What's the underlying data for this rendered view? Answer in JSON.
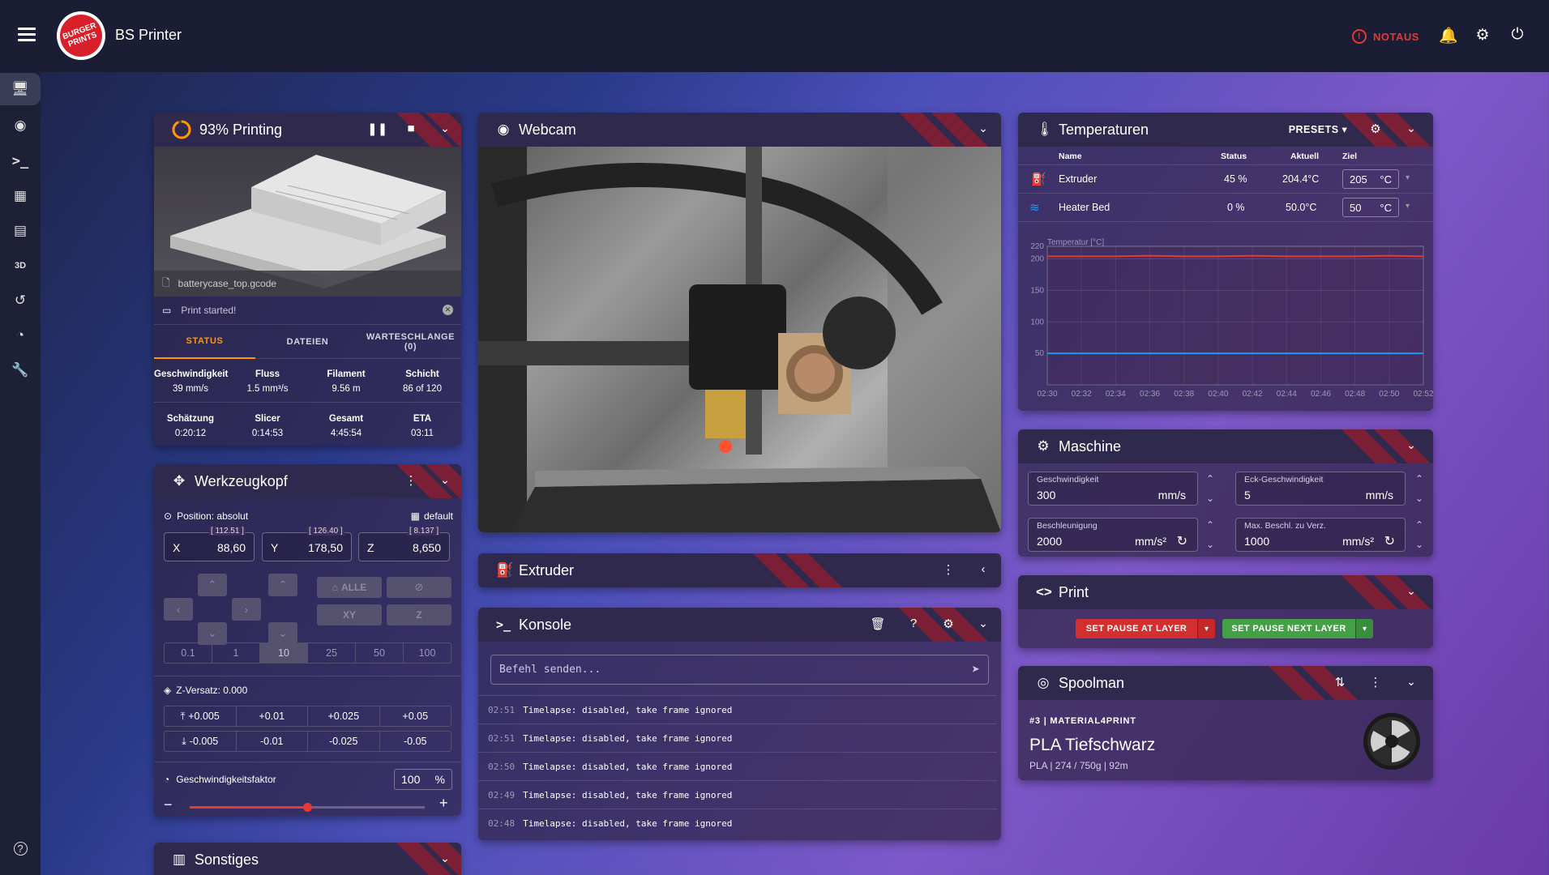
{
  "app": {
    "title": "BS Printer",
    "logo_text": "BURGER PRINTS",
    "notaus": "NOTAUS"
  },
  "colors": {
    "accent": "#e53935",
    "stripe": "#7a1f36",
    "panel_header": "#2f2a4d",
    "progress": "#ff9800",
    "green": "#4caf50"
  },
  "sidebar": {
    "items": [
      "dashboard-icon",
      "webcam-icon",
      "console-icon",
      "heightmap-icon",
      "files-icon",
      "3d-viewer-icon",
      "history-icon",
      "timelapse-icon",
      "settings-icon"
    ],
    "help": "?",
    "label_3d": "3D"
  },
  "status": {
    "title": "93% Printing",
    "progress": 0.93,
    "filename": "batterycase_top.gcode",
    "message": "Print started!",
    "tabs": [
      "STATUS",
      "DATEIEN",
      "WARTESCHLANGE (0)"
    ],
    "stats1": [
      {
        "label": "Geschwindigkeit",
        "value": "39 mm/s"
      },
      {
        "label": "Fluss",
        "value": "1.5 mm³/s"
      },
      {
        "label": "Filament",
        "value": "9.56 m"
      },
      {
        "label": "Schicht",
        "value": "86 of 120"
      }
    ],
    "stats2": [
      {
        "label": "Schätzung",
        "value": "0:20:12"
      },
      {
        "label": "Slicer",
        "value": "0:14:53"
      },
      {
        "label": "Gesamt",
        "value": "4:45:54"
      },
      {
        "label": "ETA",
        "value": "03:11"
      }
    ]
  },
  "toolhead": {
    "title": "Werkzeugkopf",
    "position_label": "Position: absolut",
    "profile": "default",
    "axes": [
      {
        "axis": "X",
        "value": "88,60",
        "raw": "[ 112.51 ]"
      },
      {
        "axis": "Y",
        "value": "178,50",
        "raw": "[ 126.40 ]"
      },
      {
        "axis": "Z",
        "value": "8,650",
        "raw": "[ 8.137 ]"
      }
    ],
    "home_all": "ALLE",
    "home_xy": "XY",
    "home_z": "Z",
    "steps": [
      "0.1",
      "1",
      "10",
      "25",
      "50",
      "100"
    ],
    "selected_step": "10",
    "zoffset_label": "Z-Versatz: 0.000",
    "zoffset_up": [
      "+0.005",
      "+0.01",
      "+0.025",
      "+0.05"
    ],
    "zoffset_down": [
      "-0.005",
      "-0.01",
      "-0.025",
      "-0.05"
    ],
    "speed_factor_label": "Geschwindigkeitsfaktor",
    "speed_factor": "100",
    "speed_factor_unit": "%",
    "speed_factor_level": 0.5
  },
  "misc": {
    "title": "Sonstiges"
  },
  "webcam": {
    "title": "Webcam"
  },
  "extruder": {
    "title": "Extruder"
  },
  "console": {
    "title": "Konsole",
    "placeholder": "Befehl senden...",
    "lines": [
      {
        "time": "02:51",
        "text": "Timelapse: disabled, take frame ignored"
      },
      {
        "time": "02:51",
        "text": "Timelapse: disabled, take frame ignored"
      },
      {
        "time": "02:50",
        "text": "Timelapse: disabled, take frame ignored"
      },
      {
        "time": "02:49",
        "text": "Timelapse: disabled, take frame ignored"
      },
      {
        "time": "02:48",
        "text": "Timelapse: disabled, take frame ignored"
      }
    ]
  },
  "temperatures": {
    "title": "Temperaturen",
    "presets": "PRESETS",
    "headers": [
      "Name",
      "Status",
      "Aktuell",
      "Ziel"
    ],
    "rows": [
      {
        "name": "Extruder",
        "status": "45 %",
        "current": "204.4°C",
        "target": "205",
        "unit": "°C"
      },
      {
        "name": "Heater Bed",
        "status": "0 %",
        "current": "50.0°C",
        "target": "50",
        "unit": "°C"
      }
    ]
  },
  "chart_data": {
    "type": "line",
    "ylabel": "Temperatur [°C]",
    "ylim": [
      0,
      220
    ],
    "yticks": [
      50,
      100,
      150,
      200,
      220
    ],
    "x": [
      "02:30",
      "02:32",
      "02:34",
      "02:36",
      "02:38",
      "02:40",
      "02:42",
      "02:44",
      "02:46",
      "02:48",
      "02:50",
      "02:52"
    ],
    "series": [
      {
        "values": [
          204,
          204,
          204,
          205,
          204,
          204,
          205,
          204,
          204,
          204,
          205,
          204
        ],
        "color": "#e53935"
      },
      {
        "values": [
          50,
          50,
          50,
          50,
          50,
          50,
          50,
          50,
          50,
          50,
          50,
          50
        ],
        "color": "#2196f3"
      }
    ]
  },
  "machine": {
    "title": "Maschine",
    "fields": [
      {
        "label": "Geschwindigkeit",
        "value": "300",
        "unit": "mm/s"
      },
      {
        "label": "Eck-Geschwindigkeit",
        "value": "5",
        "unit": "mm/s"
      },
      {
        "label": "Beschleunigung",
        "value": "2000",
        "unit": "mm/s²"
      },
      {
        "label": "Max. Beschl. zu Verz.",
        "value": "1000",
        "unit": "mm/s²"
      }
    ]
  },
  "print": {
    "title": "Print",
    "pause_layer": "SET PAUSE AT LAYER",
    "pause_next": "SET PAUSE NEXT LAYER"
  },
  "spoolman": {
    "title": "Spoolman",
    "vendor": "#3 | MATERIAL4PRINT",
    "name": "PLA Tiefschwarz",
    "details": "PLA | 274 / 750g | 92m"
  }
}
